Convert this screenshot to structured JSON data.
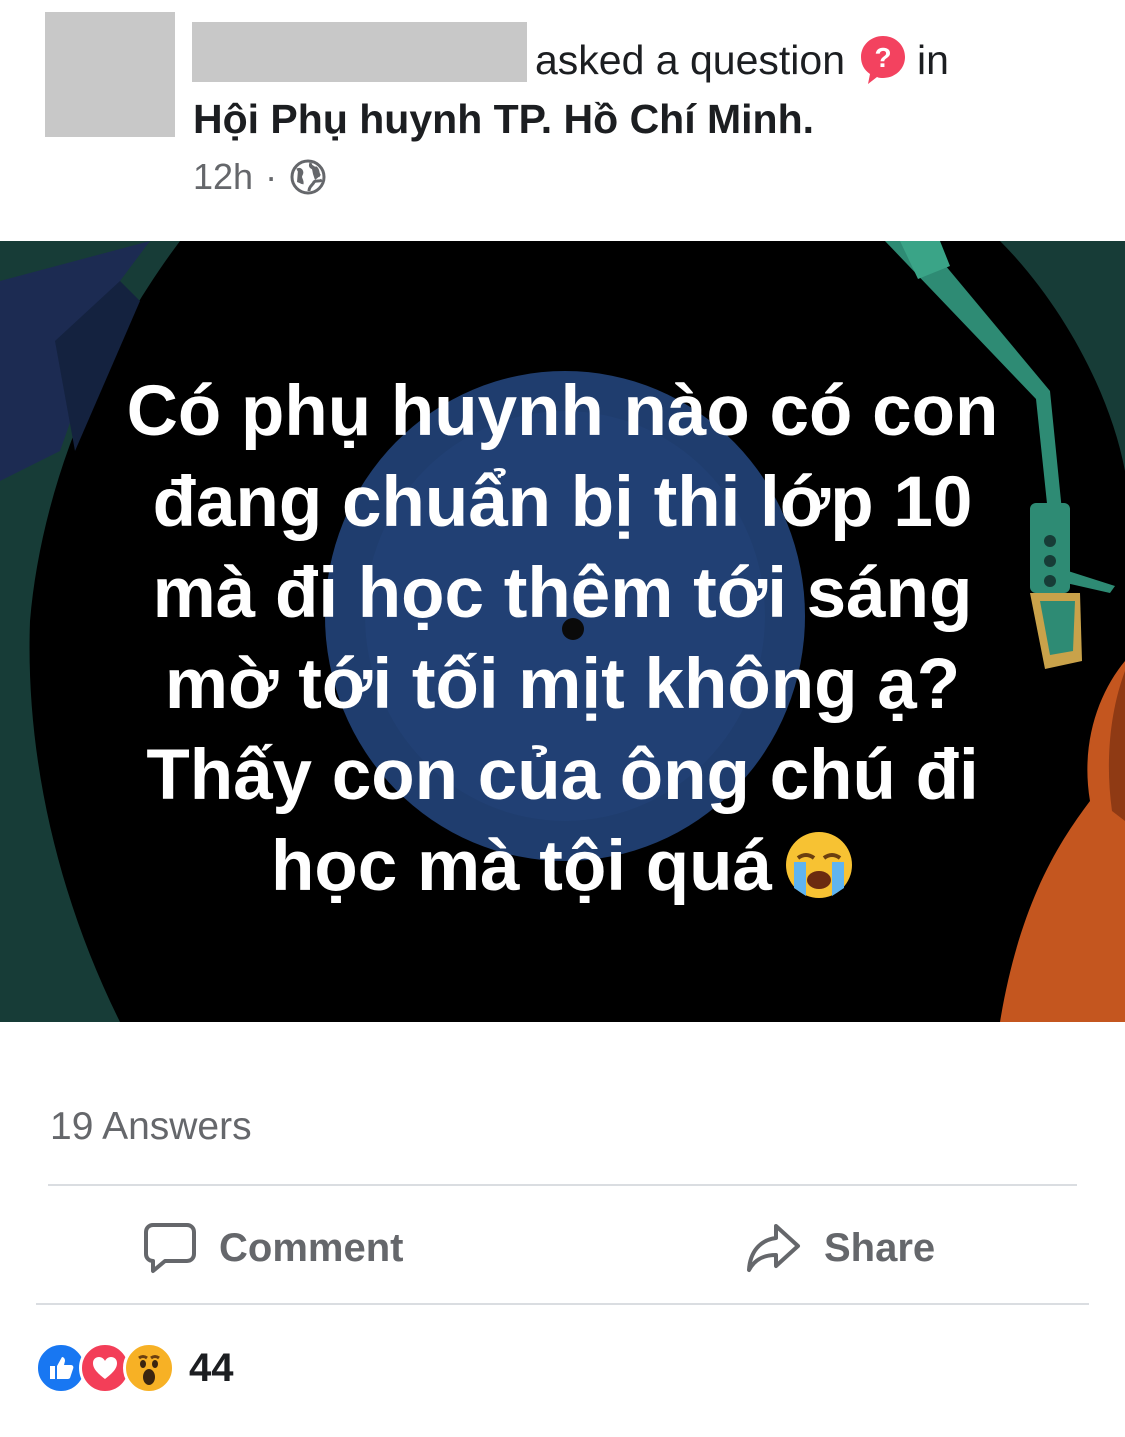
{
  "post": {
    "asked_text": "asked a question",
    "in_text": "in",
    "group_name": "Hội Phụ huynh TP. Hồ Chí Minh.",
    "time": "12h",
    "separator": "·",
    "privacy_icon": "globe-icon",
    "question_icon": "question-badge-icon"
  },
  "banner": {
    "text": "Có phụ huynh nào có con\nđang chuẩn bị thi lớp 10\nmà đi học thêm tới sáng\nmờ tới tối mịt không ạ?\nThấy con của ông chú đi\nhọc mà tội quá",
    "emoji": "crying-face-emoji",
    "colors": {
      "background": "#000000",
      "record": "#1f3d6e",
      "green": "#2e8b74",
      "orange": "#c4561f"
    }
  },
  "stats": {
    "answers": "19 Answers"
  },
  "actions": {
    "comment": "Comment",
    "share": "Share"
  },
  "reactions": {
    "icons": [
      "like-icon",
      "love-icon",
      "wow-icon"
    ],
    "count": "44",
    "colors": {
      "like": "#1877f2",
      "love": "#f33e58",
      "wow": "#f7b125"
    }
  }
}
